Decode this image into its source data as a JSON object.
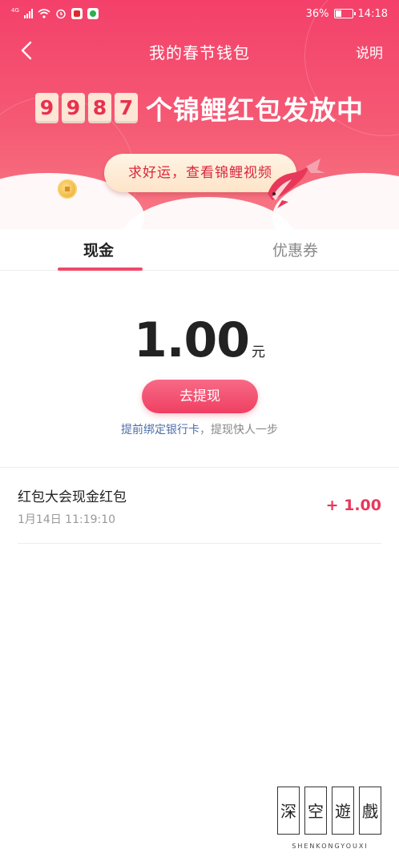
{
  "statusbar": {
    "network": "4G",
    "battery": "36%",
    "time": "14:18"
  },
  "nav": {
    "title": "我的春节钱包",
    "help_label": "说明"
  },
  "banner": {
    "digits": [
      "9",
      "9",
      "8",
      "7"
    ],
    "counter_text": "个锦鲤红包发放中",
    "lucky_button_label": "求好运，查看锦鲤视频"
  },
  "tabs": [
    {
      "label": "现金",
      "selected": true
    },
    {
      "label": "优惠券",
      "selected": false
    }
  ],
  "balance": {
    "amount": "1.00",
    "unit": "元",
    "withdraw_label": "去提现",
    "bind_link": "提前绑定银行卡",
    "bind_rest": "，提现快人一步"
  },
  "transactions": [
    {
      "title": "红包大会现金红包",
      "time": "1月14日 11:19:10",
      "amount": "+ 1.00"
    }
  ],
  "watermark": {
    "chars": [
      "深",
      "空",
      "遊",
      "戲"
    ],
    "text": "SHENKONGYOUXI"
  },
  "colors": {
    "header": "#f4406a",
    "accent": "#f04a6a",
    "amount_positive": "#e8375b",
    "link": "#4d6ea8"
  }
}
